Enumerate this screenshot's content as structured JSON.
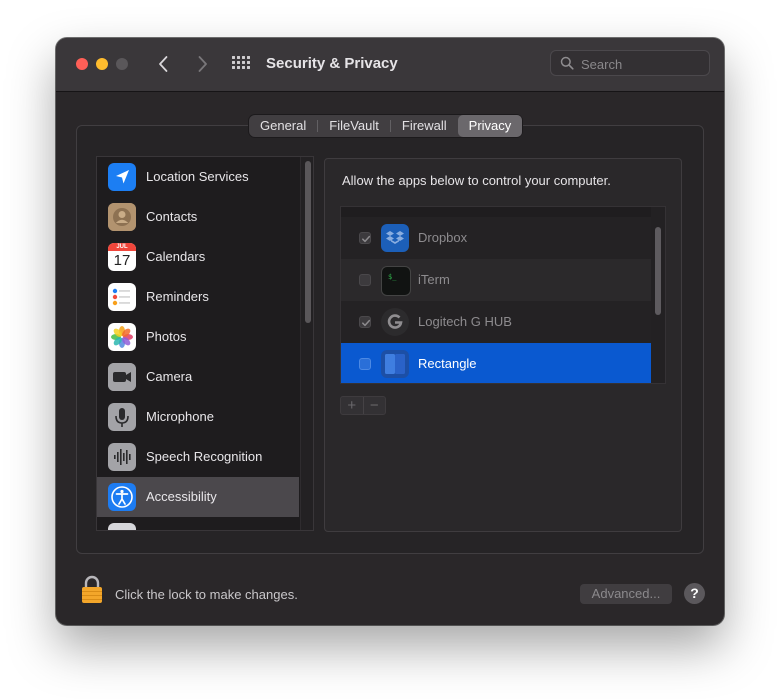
{
  "window": {
    "title": "Security & Privacy",
    "search_placeholder": "Search"
  },
  "tabs": [
    {
      "label": "General",
      "active": false
    },
    {
      "label": "FileVault",
      "active": false
    },
    {
      "label": "Firewall",
      "active": false
    },
    {
      "label": "Privacy",
      "active": true
    }
  ],
  "sidebar": {
    "items": [
      {
        "label": "Location Services",
        "icon": "location-arrow-icon"
      },
      {
        "label": "Contacts",
        "icon": "contacts-icon"
      },
      {
        "label": "Calendars",
        "icon": "calendar-icon",
        "icon_month": "JUL",
        "icon_day": "17"
      },
      {
        "label": "Reminders",
        "icon": "reminders-icon"
      },
      {
        "label": "Photos",
        "icon": "photos-icon"
      },
      {
        "label": "Camera",
        "icon": "camera-icon"
      },
      {
        "label": "Microphone",
        "icon": "microphone-icon"
      },
      {
        "label": "Speech Recognition",
        "icon": "speech-waveform-icon"
      },
      {
        "label": "Accessibility",
        "icon": "accessibility-icon",
        "selected": true
      }
    ]
  },
  "panel": {
    "description": "Allow the apps below to control your computer.",
    "apps": [
      {
        "name": "Dropbox",
        "checked": true,
        "icon": "dropbox-icon"
      },
      {
        "name": "iTerm",
        "checked": false,
        "icon": "iterm-icon"
      },
      {
        "name": "Logitech G HUB",
        "checked": true,
        "icon": "logitech-g-icon"
      },
      {
        "name": "Rectangle",
        "checked": false,
        "selected": true,
        "icon": "rectangle-icon"
      }
    ],
    "add_label": "+",
    "remove_label": "−"
  },
  "footer": {
    "lock_text": "Click the lock to make changes.",
    "advanced_label": "Advanced...",
    "help_label": "?"
  },
  "colors": {
    "selection_blue": "#0a59d0",
    "window_bg": "#2a2729",
    "accent_blue": "#1d7cf2"
  }
}
